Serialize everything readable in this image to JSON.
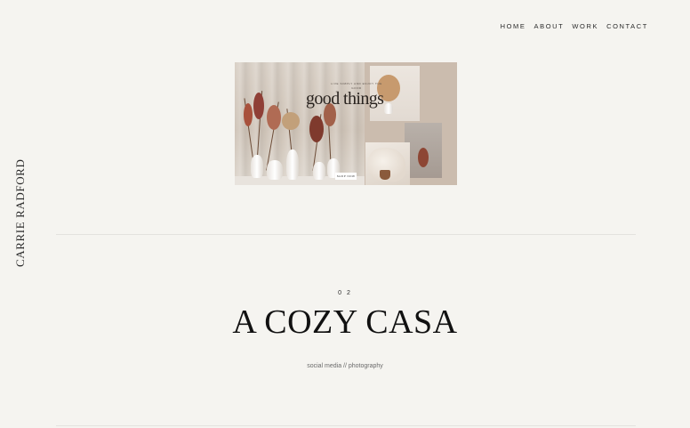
{
  "nav": {
    "items": [
      {
        "label": "HOME"
      },
      {
        "label": "ABOUT"
      },
      {
        "label": "WORK"
      },
      {
        "label": "CONTACT"
      }
    ]
  },
  "brand": {
    "name": "CARRIE RADFORD"
  },
  "mockup": {
    "tagline": "LIVE SIMPLY AND ENJOY THE GOOD",
    "headline": "good things",
    "button_label": "SHOP NOW"
  },
  "project": {
    "number": "02",
    "title": "A COZY CASA",
    "tags": "social media // photography"
  },
  "colors": {
    "background": "#f5f4f0",
    "text": "#111111",
    "muted": "#6a6a6a",
    "divider": "#e3e2de"
  }
}
